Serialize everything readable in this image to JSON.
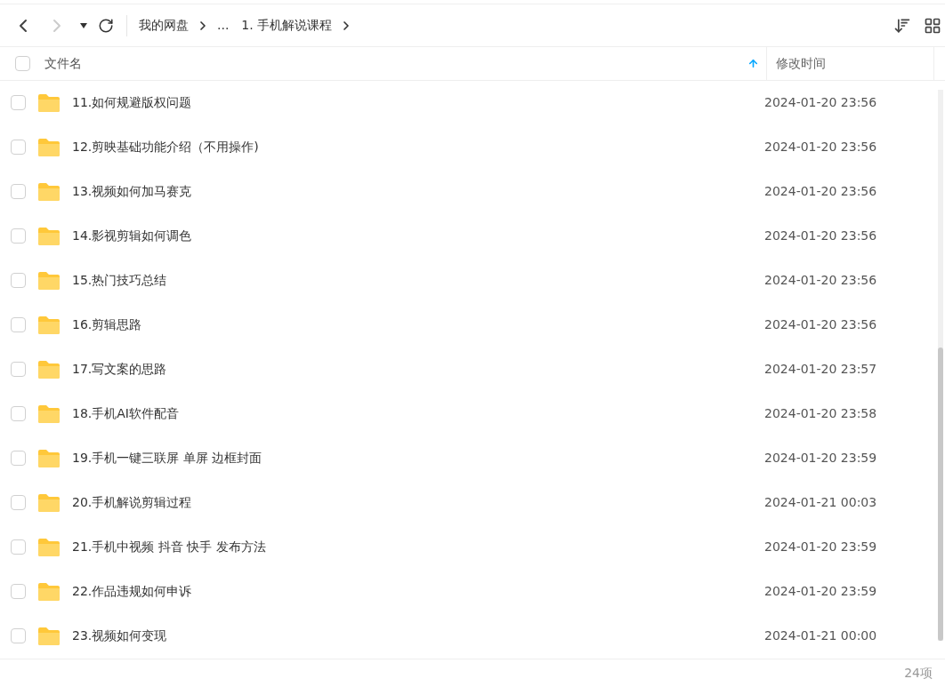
{
  "breadcrumb": [
    {
      "label": "我的网盘"
    },
    {
      "label": "..."
    },
    {
      "label": "1. 手机解说课程"
    }
  ],
  "table": {
    "select_all": {
      "checked": false
    },
    "columns": [
      {
        "label": "文件名",
        "sorted": true
      },
      {
        "label": "修改时间",
        "sorted": false
      }
    ],
    "rows": [
      {
        "name": "11.如何规避版权问题",
        "modified": "2024-01-20 23:56",
        "checked": false
      },
      {
        "name": "12.剪映基础功能介绍（不用操作)",
        "modified": "2024-01-20 23:56",
        "checked": false
      },
      {
        "name": "13.视频如何加马赛克",
        "modified": "2024-01-20 23:56",
        "checked": false
      },
      {
        "name": "14.影视剪辑如何调色",
        "modified": "2024-01-20 23:56",
        "checked": false
      },
      {
        "name": "15.热门技巧总结",
        "modified": "2024-01-20 23:56",
        "checked": false
      },
      {
        "name": "16.剪辑思路",
        "modified": "2024-01-20 23:56",
        "checked": false
      },
      {
        "name": "17.写文案的思路",
        "modified": "2024-01-20 23:57",
        "checked": false
      },
      {
        "name": "18.手机AI软件配音",
        "modified": "2024-01-20 23:58",
        "checked": false
      },
      {
        "name": "19.手机一键三联屏 单屏 边框封面",
        "modified": "2024-01-20 23:59",
        "checked": false
      },
      {
        "name": "20.手机解说剪辑过程",
        "modified": "2024-01-21 00:03",
        "checked": false
      },
      {
        "name": "21.手机中视频 抖音 快手 发布方法",
        "modified": "2024-01-20 23:59",
        "checked": false
      },
      {
        "name": "22.作品违规如何申诉",
        "modified": "2024-01-20 23:59",
        "checked": false
      },
      {
        "name": "23.视频如何变现",
        "modified": "2024-01-21 00:00",
        "checked": false
      }
    ]
  },
  "status_bar": {
    "count": "24项"
  }
}
